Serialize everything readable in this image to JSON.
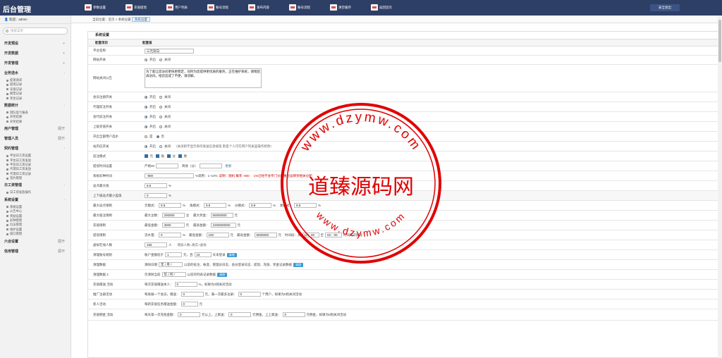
{
  "brand": "后台管理",
  "topnav": [
    "参数设置",
    "充值提现",
    "用户列表",
    "账号流程",
    "发布内容",
    "账号流程",
    "清空缓存",
    "返回首页"
  ],
  "logout_label": "安全退出",
  "user": {
    "label": "欢迎：admin"
  },
  "sidebar": {
    "search_placeholder": "搜索菜单",
    "sections": [
      {
        "title": "开发预设",
        "toggle": "+",
        "items": []
      },
      {
        "title": "开发数据",
        "toggle": "+",
        "items": []
      },
      {
        "title": "开发管理",
        "toggle": "+",
        "items": []
      },
      {
        "title": "业务选水",
        "toggle": "-",
        "items": [
          "提现请求",
          "提现记录",
          "充值记录",
          "刷票记录",
          "奖金记录"
        ]
      },
      {
        "title": "数据统计",
        "toggle": "-",
        "items": [
          "团队盈亏报表",
          "开奖结果",
          "开奖结果"
        ]
      },
      {
        "title": "用户管理",
        "toggle": "展开",
        "items": []
      },
      {
        "title": "管理人员",
        "toggle": "展开",
        "items": []
      },
      {
        "title": "契约管理",
        "toggle": "-",
        "items": [
          "平台日工资设置",
          "平台日工资发放",
          "平台日工资记录",
          "代理日工资发放",
          "代理日工资记录",
          "签约管理"
        ]
      },
      {
        "title": "日工资管理",
        "toggle": "-",
        "items": [
          "日工资发放操作"
        ]
      },
      {
        "title": "系统设置",
        "toggle": "-",
        "items": [
          "系统设置",
          "公告中心",
          "奖励设置",
          "彩种管理",
          "玩法管理",
          "维护设置",
          "接口管理"
        ]
      },
      {
        "title": "六合设置",
        "toggle": "展开",
        "items": []
      },
      {
        "title": "信用管理",
        "toggle": "展开",
        "items": []
      }
    ]
  },
  "breadcrumb": {
    "prefix": "当前位置：首页",
    "mid": "系统设置",
    "current": "系统设置"
  },
  "content": {
    "title": "系统设置",
    "col1": "配置项目",
    "col2": "配置值"
  },
  "settings": {
    "platform_name": {
      "label": "平台名称",
      "value": "三元双向"
    },
    "site_switch": {
      "label": "网站开关",
      "on": "开启",
      "off": "关闭"
    },
    "maint_notice": {
      "label": "网站关闭公告",
      "value": "为了能让您访问更快更稳定，同时为您提供更优质的服务，正在维护系统，请稍后再访问。给您造成了不便，请谅解。"
    },
    "reg_switch": {
      "label": "会员注册开关",
      "on": "开启",
      "off": "关闭"
    },
    "agent_reg": {
      "label": "代理前注开关",
      "on": "开启",
      "off": "关闭"
    },
    "proxy_reg": {
      "label": "会代前注开关",
      "on": "开启",
      "off": "关闭"
    },
    "upper_recharge": {
      "label": "上级充值开关",
      "on": "开启",
      "off": "关闭"
    },
    "all_member": {
      "label": "开启全部用户选水",
      "on": "是",
      "off": "否"
    },
    "lottery_switch": {
      "label": "站内信开关",
      "on": "开启",
      "off": "关闭",
      "note": "（关闭则不显示商司发送信息按钮 默是个人可在用户列表里操作修改）"
    },
    "mode": {
      "label": "前注模式",
      "opts": [
        "元",
        "角",
        "分",
        "厘"
      ]
    },
    "withdraw_time": {
      "label": "提现时间设置",
      "a": "严格00",
      "b": "简易（分）",
      "link": "更新"
    },
    "coin_range": {
      "label": "系统彩种时间",
      "value": "-900",
      "hint1": "%调用：1~10%",
      "red1": "说明：随机 概率 -900",
      "red2": "1%已经不会专门分配重过返降奖相关分配"
    },
    "rebate_max": {
      "label": "返点最大值",
      "value": "9.9",
      "unit": "%"
    },
    "rebate_low": {
      "label": "上下级返点最小差值",
      "value": "0",
      "unit": "%"
    },
    "max_rebate": {
      "label": "最大返点限制",
      "m1": "元模式：",
      "v1": "9.9",
      "m2": "角模式：",
      "v2": "9.9",
      "m3": "分模式：",
      "v3": "9.9",
      "m4": "厘模式：",
      "v4": "9.9",
      "unit": "%"
    },
    "max_bonus": {
      "label": "最大赔注限制",
      "a": "最大注数：",
      "av": "200000",
      "au": "注",
      "b": "最大奖金：",
      "bv": "50000000",
      "bu": "元"
    },
    "recharge_limit": {
      "label": "充值限制",
      "a": "最低金额：",
      "av": "3000",
      "au": "元",
      "b": "最高金额：",
      "bv": "1000000000",
      "bu": "元"
    },
    "withdraw_limit": {
      "label": "提现限制",
      "a": "流水量：",
      "av": "0",
      "au": "%",
      "b": "最低金额：",
      "bv": "100",
      "bu": "元",
      "c": "最高金额：",
      "cv": "5000000",
      "cu": "元",
      "d": "时间段：从",
      "dv": "10：00",
      "e": "至",
      "ev": "02：00",
      "f": "时间内可提现"
    },
    "online_num": {
      "label": "虚拟在线人数",
      "value": "156",
      "unit": "人",
      "note": "增加人数=真实+虚拟"
    },
    "clean_acc": {
      "label": "清理账号规则",
      "a": "账户金额低于",
      "av": "1",
      "au": "元，且",
      "bv": "15",
      "bu": "天未登录",
      "btn": "清理"
    },
    "clean_data": {
      "label": "清理数据",
      "a": "清除日期",
      "av": "年 / 月 /",
      "b": "以前的投注、帐变、管理员日志、会员登录日志、提现、充值、奖金记录数据",
      "btn": "清理"
    },
    "clean_data2": {
      "label": "清理数据 2",
      "a": "仅清除当前",
      "av": "年 / 月 /",
      "b": "以前的列表记录数据",
      "btn": "清理"
    },
    "recharge_gift": {
      "label": "充值赠送 活动",
      "a": "每次充值赠送本人：",
      "av": "0",
      "b": "%，如果为0则关闭活动"
    },
    "recommend": {
      "label": "推广注册活动",
      "a": "每发展一个会员，赠送：",
      "av": "0",
      "au": "元，满一次最多注册：",
      "bv": "0",
      "b": "个用户，如果为0则关闭活动"
    },
    "new_gift": {
      "label": "新人活动",
      "a": "每新充值任务赠送金额：",
      "av": "0",
      "au": "元"
    },
    "recharge_comm": {
      "label": "充值佣金 活动",
      "a": "每天第一次充值金额：",
      "av": "0",
      "au": "元以上，上家送：",
      "bv": "0",
      "bu": "元佣金，上上家送：",
      "cv": "0",
      "cu": "元佣金，如果为0则关闭活动"
    }
  },
  "watermark": {
    "top": "www.dzymw.com",
    "center": "道臻源码网",
    "bottom": "www.dzymw.com"
  }
}
